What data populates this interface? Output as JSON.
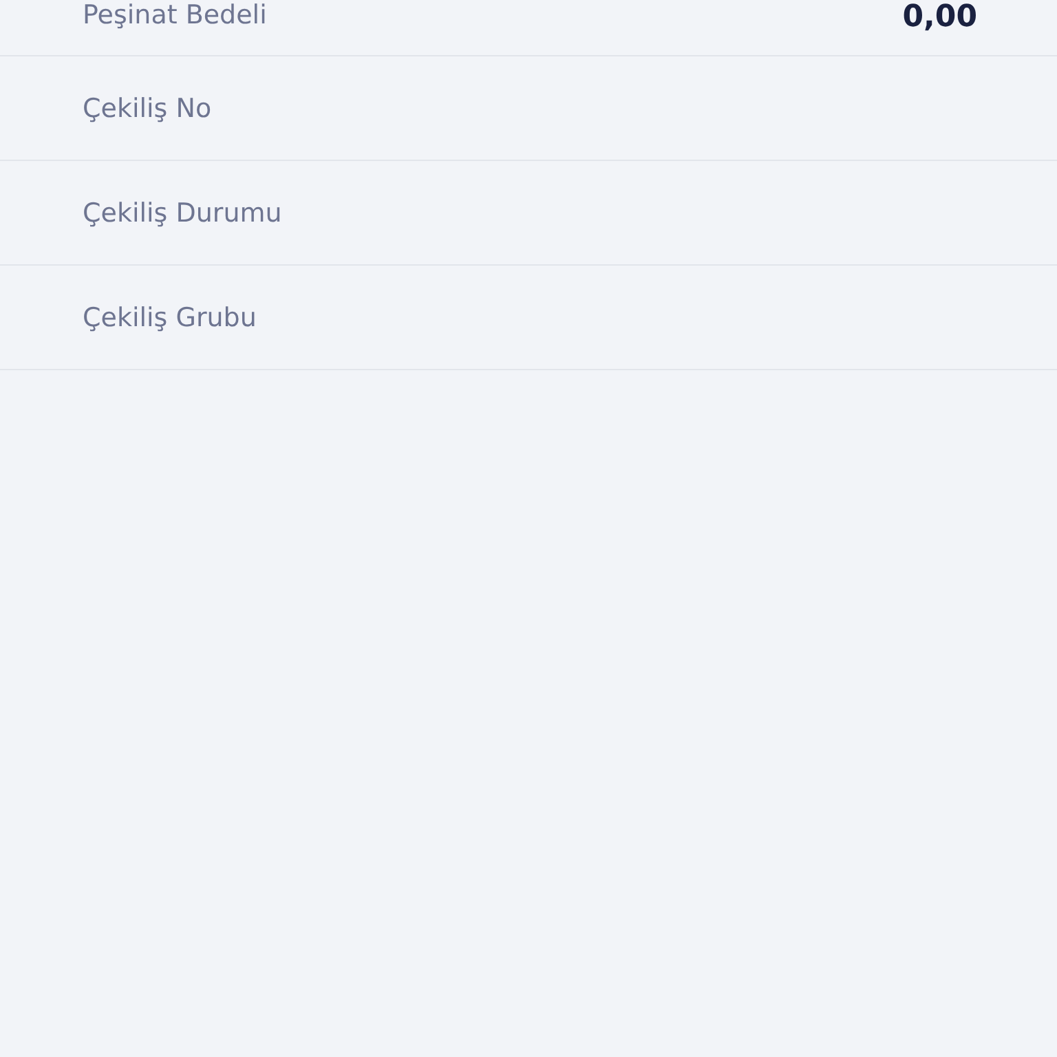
{
  "rows": [
    {
      "label": "Peşinat Bedeli",
      "value": "0,00"
    },
    {
      "label": "Çekiliş No"
    },
    {
      "label": "Çekiliş Durumu"
    },
    {
      "label": "Çekiliş Grubu"
    }
  ]
}
